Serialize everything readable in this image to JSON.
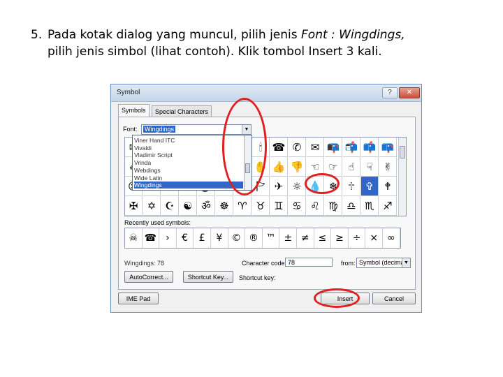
{
  "instruction": {
    "number": "5.",
    "line1_pre": "Pada kotak dialog yang muncul, pilih jenis ",
    "line1_em": "Font : Wingdings,",
    "line2": "pilih jenis simbol (lihat contoh). Klik tombol Insert 3 kali."
  },
  "dialog": {
    "title": "Symbol",
    "tabs": [
      "Symbols",
      "Special Characters"
    ],
    "font_label": "Font:",
    "font_value": "Wingdings",
    "font_list": [
      "Viner Hand ITC",
      "Vivaldi",
      "Vladimir Script",
      "Vrinda",
      "Webdings",
      "Wide Latin",
      "Wingdings"
    ],
    "font_list_selected": "Wingdings",
    "grid_rows": [
      [
        "✉",
        "☂",
        "✂",
        "✁",
        "👓",
        "🔔",
        "📖",
        "🕯",
        "☎",
        "✆",
        "✉",
        "📭",
        "📬",
        "📫",
        "📪"
      ],
      [
        "✐",
        "💻",
        "🖮",
        "🖫",
        "🖬",
        "✇",
        "✍",
        "✋",
        "👍",
        "👎",
        "☜",
        "☞",
        "☝",
        "☟",
        "✌"
      ],
      [
        "☹",
        "☺",
        "☹",
        "☹",
        "💣",
        "☠",
        "⚐",
        "🏱",
        "✈",
        "☼",
        "💧",
        "❄",
        "🕆",
        "✞",
        "🕈"
      ],
      [
        "✠",
        "✡",
        "☪",
        "☯",
        "ॐ",
        "☸",
        "♈",
        "♉",
        "♊",
        "♋",
        "♌",
        "♍",
        "♎",
        "♏",
        "♐"
      ]
    ],
    "selected_symbol": "☠",
    "recent_label": "Recently used symbols:",
    "recent": [
      "☠",
      "☎",
      "›",
      "€",
      "£",
      "¥",
      "©",
      "®",
      "™",
      "±",
      "≠",
      "≤",
      "≥",
      "÷",
      "×",
      "∞"
    ],
    "wingdings_label": "Wingdings: 78",
    "char_code_label": "Character code:",
    "char_code_value": "78",
    "from_label": "from:",
    "from_value": "Symbol (decimal)",
    "autocorrect_label": "AutoCorrect...",
    "shortcut_key_btn": "Shortcut Key...",
    "shortcut_key_label": "Shortcut key:",
    "ime_pad": "IME Pad",
    "insert": "Insert",
    "cancel": "Cancel"
  },
  "annotation_color": "#e02020"
}
